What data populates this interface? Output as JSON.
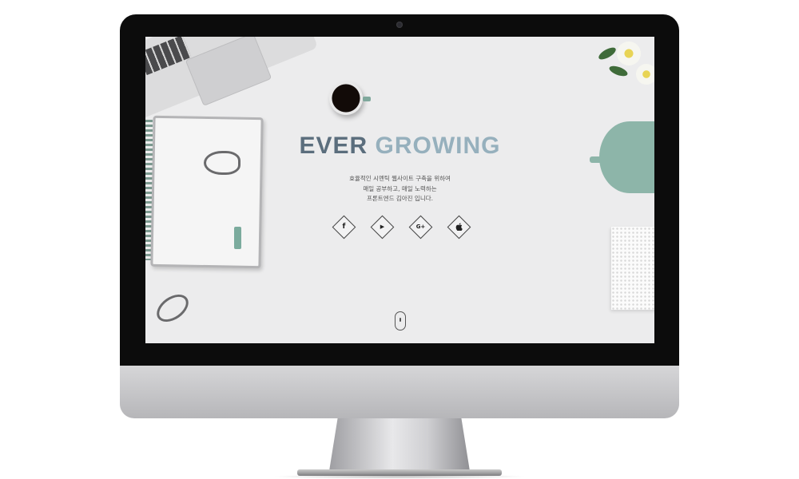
{
  "hero": {
    "title_word_1": "EVER",
    "title_word_2": "GROWING",
    "tagline_lines": [
      "효율적인 시멘틱 웹사이트 구축을 위하여",
      "매일 공부하고, 매일 노력하는",
      "프론트엔드 김아진 입니다."
    ]
  },
  "social_links": [
    {
      "icon": "facebook-icon",
      "glyph": "f"
    },
    {
      "icon": "youtube-icon",
      "glyph": "▶"
    },
    {
      "icon": "google-plus-icon",
      "glyph": "G+"
    },
    {
      "icon": "apple-icon",
      "glyph": ""
    }
  ],
  "scroll_indicator": {
    "icon": "mouse-scroll-icon"
  },
  "colors": {
    "title_dark": "#5b6e7d",
    "title_light": "#96b0bd",
    "accent_mint": "#7fa89c",
    "screen_bg": "#ececed",
    "bezel": "#0c0c0c"
  }
}
